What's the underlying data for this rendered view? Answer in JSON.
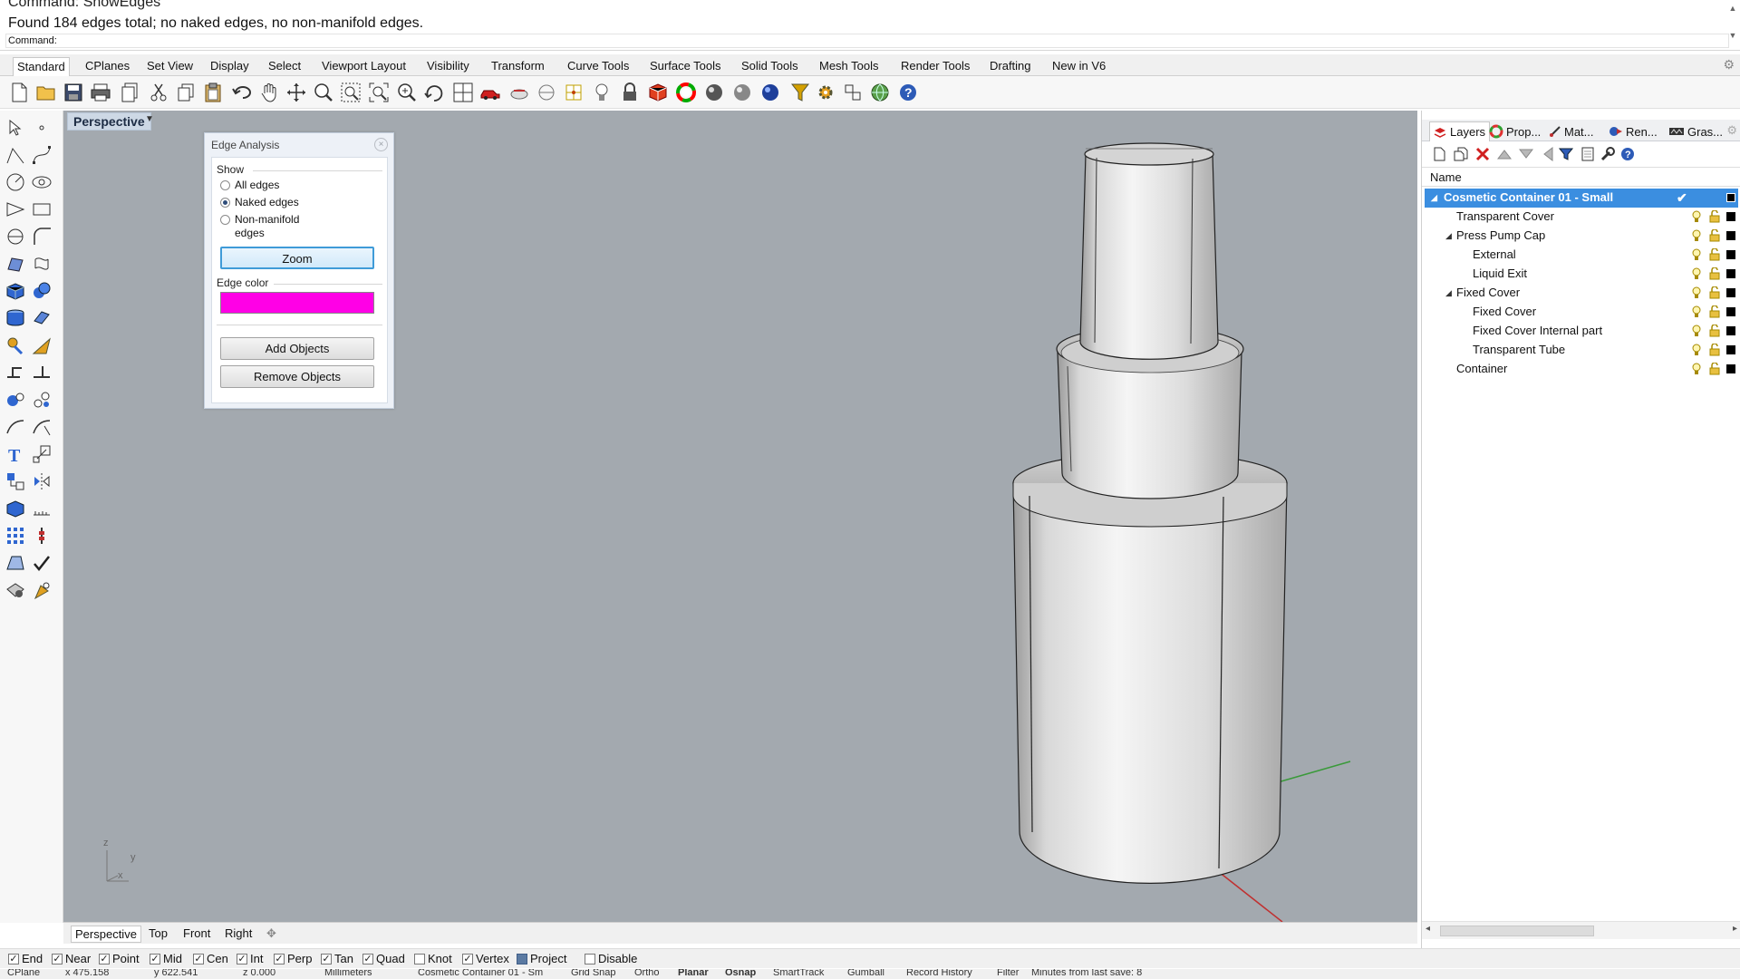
{
  "command": {
    "history_line1": "Command: ShowEdges",
    "history_line2": "Found 184 edges total; no naked edges, no non-manifold edges.",
    "prompt": "Command:"
  },
  "tabs": [
    "Standard",
    "CPlanes",
    "Set View",
    "Display",
    "Select",
    "Viewport Layout",
    "Visibility",
    "Transform",
    "Curve Tools",
    "Surface Tools",
    "Solid Tools",
    "Mesh Tools",
    "Render Tools",
    "Drafting",
    "New in V6"
  ],
  "toolbar_icons": [
    "new-icon",
    "open-icon",
    "save-icon",
    "print-icon",
    "import-icon",
    "cut-icon",
    "copy-icon",
    "paste-icon",
    "undo-icon",
    "pan-icon",
    "rotate-view-icon",
    "zoom-icon",
    "zoom-window-icon",
    "zoom-extents-icon",
    "zoom-selected-icon",
    "rotate-icon",
    "four-viewports-icon",
    "car-icon",
    "named-views-icon",
    "circle-icon",
    "grid-icon",
    "light-icon",
    "lock-icon",
    "material-icon",
    "color-wheel-icon",
    "sphere-shaded-icon",
    "sphere-gray-icon",
    "sphere-blue-icon",
    "filter-icon",
    "gear-icon",
    "snap-icon",
    "globe-icon",
    "help-icon"
  ],
  "viewport": {
    "title": "Perspective",
    "tabs": [
      "Perspective",
      "Top",
      "Front",
      "Right"
    ],
    "axis_labels": {
      "z": "z",
      "y": "y",
      "x": "x"
    }
  },
  "edge_analysis": {
    "title": "Edge Analysis",
    "show_label": "Show",
    "options": [
      "All edges",
      "Naked edges",
      "Non-manifold edges"
    ],
    "selected_option": "Naked edges",
    "zoom_label": "Zoom",
    "edge_color_label": "Edge color",
    "edge_color": "#ff00e6",
    "add_objects_label": "Add Objects",
    "remove_objects_label": "Remove Objects"
  },
  "panel": {
    "tabs": [
      "Layers",
      "Prop...",
      "Mat...",
      "Ren...",
      "Gras..."
    ],
    "column_name": "Name",
    "layers": [
      {
        "name": "Cosmetic Container 01 - Small",
        "selected": true
      },
      {
        "name": "Transparent Cover"
      },
      {
        "name": "Press Pump Cap"
      },
      {
        "name": "External"
      },
      {
        "name": "Liquid Exit"
      },
      {
        "name": "Fixed Cover"
      },
      {
        "name": "Fixed Cover"
      },
      {
        "name": "Fixed Cover Internal part"
      },
      {
        "name": "Transparent Tube"
      },
      {
        "name": "Container"
      }
    ]
  },
  "osnaps": [
    {
      "label": "End",
      "checked": true
    },
    {
      "label": "Near",
      "checked": true
    },
    {
      "label": "Point",
      "checked": true
    },
    {
      "label": "Mid",
      "checked": true
    },
    {
      "label": "Cen",
      "checked": true
    },
    {
      "label": "Int",
      "checked": true
    },
    {
      "label": "Perp",
      "checked": true
    },
    {
      "label": "Tan",
      "checked": true
    },
    {
      "label": "Quad",
      "checked": true
    },
    {
      "label": "Knot",
      "checked": false
    },
    {
      "label": "Vertex",
      "checked": true
    },
    {
      "label": "Project",
      "checked": true
    },
    {
      "label": "Disable",
      "checked": false
    }
  ],
  "status": {
    "cplane": "CPlane",
    "x": "x 475.158",
    "y": "y 622.541",
    "z": "z 0.000",
    "units": "Millimeters",
    "layer": "Cosmetic Container 01 - Sm",
    "grid_snap": "Grid Snap",
    "ortho": "Ortho",
    "planar": "Planar",
    "osnap": "Osnap",
    "smarttrack": "SmartTrack",
    "gumball": "Gumball",
    "record_history": "Record History",
    "filter": "Filter",
    "save_msg": "Minutes from last save: 8"
  },
  "colors": {
    "viewport_bg": "#a3a9af",
    "selection": "#3b8ee0",
    "edge_color": "#ff00e6"
  }
}
